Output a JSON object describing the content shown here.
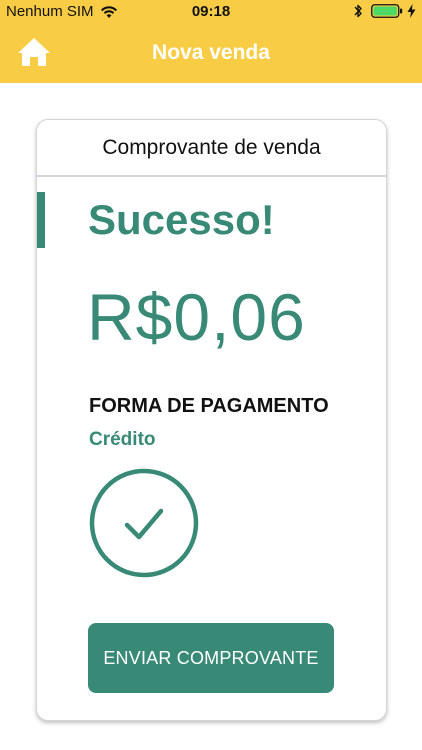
{
  "status_bar": {
    "carrier": "Nenhum SIM",
    "time": "09:18",
    "icons": [
      "wifi-icon",
      "bluetooth-icon",
      "battery-icon",
      "charging-bolt-icon"
    ]
  },
  "nav": {
    "home_icon": "home-icon",
    "title": "Nova venda"
  },
  "receipt": {
    "header": "Comprovante de venda",
    "status": "Sucesso!",
    "amount": "R$0,06",
    "payment_label": "FORMA DE PAGAMENTO",
    "payment_method": "Crédito",
    "confirm_icon": "check-circle-icon",
    "send_button": "ENVIAR COMPROVANTE"
  },
  "colors": {
    "header_yellow": "#f8cd45",
    "accent_green": "#388a76",
    "battery_green": "#4cd964"
  }
}
